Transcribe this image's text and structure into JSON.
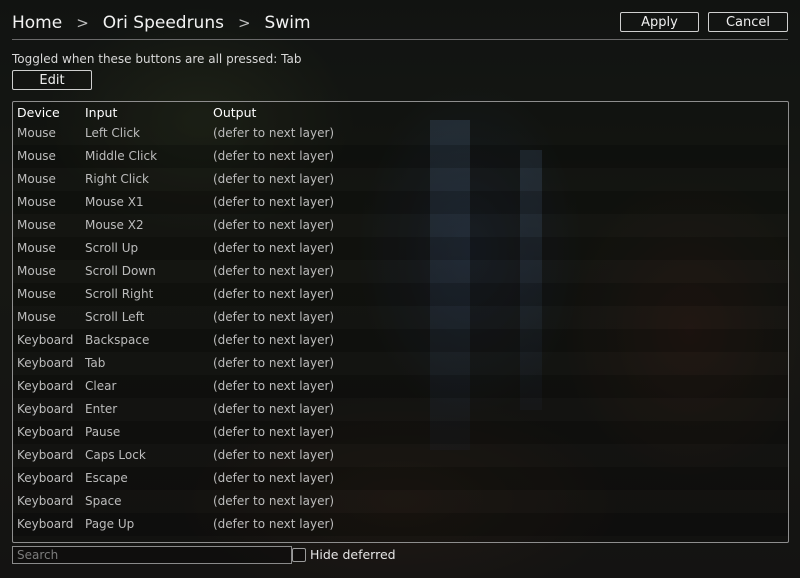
{
  "breadcrumb": [
    "Home",
    "Ori Speedruns",
    "Swim"
  ],
  "breadcrumb_separator": ">",
  "actions": {
    "apply_label": "Apply",
    "cancel_label": "Cancel"
  },
  "toggle_text": "Toggled when these buttons are all pressed: Tab",
  "edit_label": "Edit",
  "table": {
    "headers": [
      "Device",
      "Input",
      "Output"
    ],
    "rows": [
      [
        "Mouse",
        "Left Click",
        "(defer to next layer)"
      ],
      [
        "Mouse",
        "Middle Click",
        "(defer to next layer)"
      ],
      [
        "Mouse",
        "Right Click",
        "(defer to next layer)"
      ],
      [
        "Mouse",
        "Mouse X1",
        "(defer to next layer)"
      ],
      [
        "Mouse",
        "Mouse X2",
        "(defer to next layer)"
      ],
      [
        "Mouse",
        "Scroll Up",
        "(defer to next layer)"
      ],
      [
        "Mouse",
        "Scroll Down",
        "(defer to next layer)"
      ],
      [
        "Mouse",
        "Scroll Right",
        "(defer to next layer)"
      ],
      [
        "Mouse",
        "Scroll Left",
        "(defer to next layer)"
      ],
      [
        "Keyboard",
        "Backspace",
        "(defer to next layer)"
      ],
      [
        "Keyboard",
        "Tab",
        "(defer to next layer)"
      ],
      [
        "Keyboard",
        "Clear",
        "(defer to next layer)"
      ],
      [
        "Keyboard",
        "Enter",
        "(defer to next layer)"
      ],
      [
        "Keyboard",
        "Pause",
        "(defer to next layer)"
      ],
      [
        "Keyboard",
        "Caps Lock",
        "(defer to next layer)"
      ],
      [
        "Keyboard",
        "Escape",
        "(defer to next layer)"
      ],
      [
        "Keyboard",
        "Space",
        "(defer to next layer)"
      ],
      [
        "Keyboard",
        "Page Up",
        "(defer to next layer)"
      ]
    ]
  },
  "search": {
    "placeholder": "Search",
    "value": ""
  },
  "hide_deferred": {
    "label": "Hide deferred",
    "checked": false
  }
}
